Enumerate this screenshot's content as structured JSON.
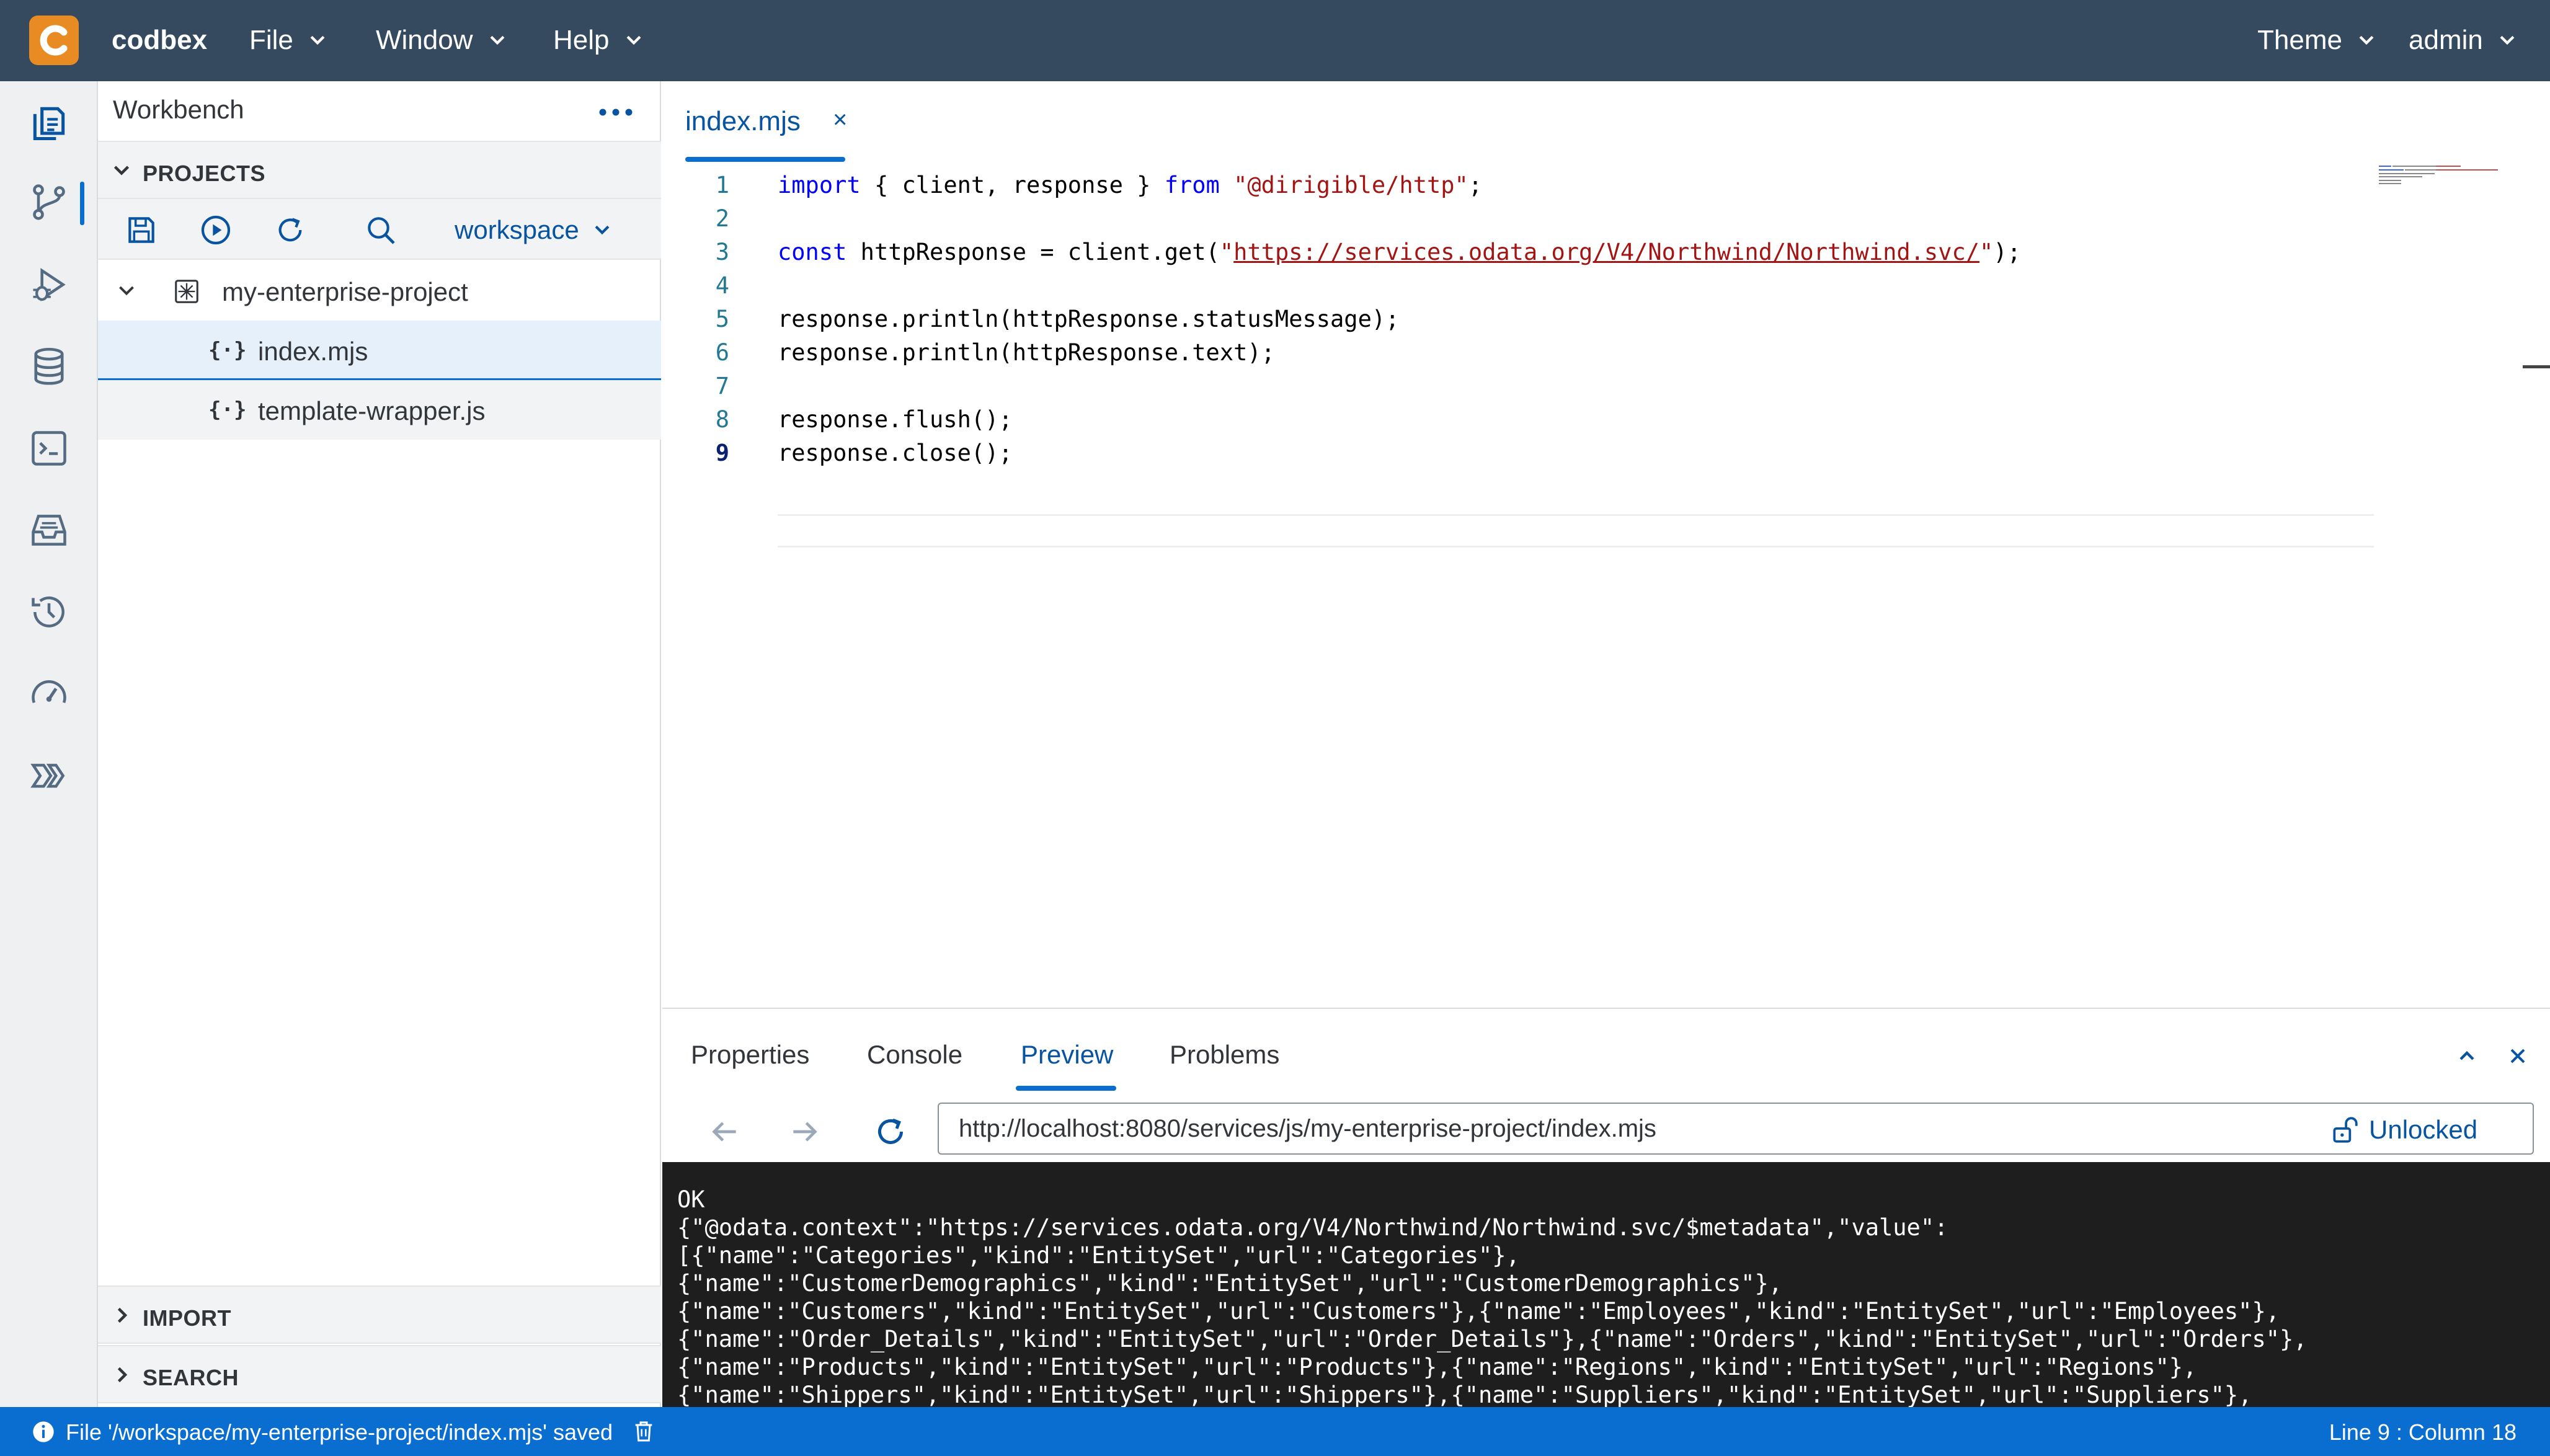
{
  "header": {
    "brand": "codbex",
    "menus": [
      {
        "label": "File"
      },
      {
        "label": "Window"
      },
      {
        "label": "Help"
      }
    ],
    "theme_label": "Theme",
    "user_label": "admin"
  },
  "activity_bar": {
    "icons": [
      "workbench-icon",
      "git-icon",
      "debug-icon",
      "database-icon",
      "terminal-icon",
      "inbox-icon",
      "history-icon",
      "dashboard-icon",
      "pipeline-icon"
    ],
    "active": "workbench-icon"
  },
  "workbench": {
    "title": "Workbench",
    "projects_label": "PROJECTS",
    "workspace_label": "workspace",
    "tree": [
      {
        "label": "my-enterprise-project",
        "type": "project"
      },
      {
        "label": "index.mjs",
        "type": "file",
        "selected": true
      },
      {
        "label": "template-wrapper.js",
        "type": "file"
      }
    ],
    "import_label": "IMPORT",
    "search_label": "SEARCH"
  },
  "editor": {
    "tab_label": "index.mjs",
    "tab_close": "×",
    "current_line": 9,
    "lines": [
      {
        "n": "1",
        "segments": [
          [
            "kw",
            "import"
          ],
          [
            "",
            "{ client, response } "
          ],
          [
            "kw",
            "from"
          ],
          [
            "",
            ""
          ],
          [
            "str",
            "\"@dirigible/http\""
          ],
          [
            "",
            ";"
          ]
        ]
      },
      {
        "n": "2",
        "segments": []
      },
      {
        "n": "3",
        "segments": [
          [
            "kw",
            "const"
          ],
          [
            "",
            " httpResponse = client.get("
          ],
          [
            "str",
            "\""
          ],
          [
            "url",
            "https://services.odata.org/V4/Northwind/Northwind.svc/"
          ],
          [
            "str",
            "\""
          ],
          [
            "",
            ");"
          ]
        ]
      },
      {
        "n": "4",
        "segments": []
      },
      {
        "n": "5",
        "segments": [
          [
            "",
            "response.println(httpResponse.statusMessage);"
          ]
        ]
      },
      {
        "n": "6",
        "segments": [
          [
            "",
            "response.println(httpResponse.text);"
          ]
        ]
      },
      {
        "n": "7",
        "segments": []
      },
      {
        "n": "8",
        "segments": [
          [
            "",
            "response.flush();"
          ]
        ]
      },
      {
        "n": "9",
        "segments": [
          [
            "",
            "response.close();"
          ]
        ]
      }
    ]
  },
  "bottom_panel": {
    "tabs": [
      {
        "label": "Properties"
      },
      {
        "label": "Console"
      },
      {
        "label": "Preview",
        "active": true
      },
      {
        "label": "Problems"
      }
    ],
    "url": "http://localhost:8080/services/js/my-enterprise-project/index.mjs",
    "lock_label": "Unlocked",
    "preview_lines": [
      "OK",
      "{\"@odata.context\":\"https://services.odata.org/V4/Northwind/Northwind.svc/$metadata\",\"value\":",
      "[{\"name\":\"Categories\",\"kind\":\"EntitySet\",\"url\":\"Categories\"},",
      "{\"name\":\"CustomerDemographics\",\"kind\":\"EntitySet\",\"url\":\"CustomerDemographics\"},",
      "{\"name\":\"Customers\",\"kind\":\"EntitySet\",\"url\":\"Customers\"},{\"name\":\"Employees\",\"kind\":\"EntitySet\",\"url\":\"Employees\"},",
      "{\"name\":\"Order_Details\",\"kind\":\"EntitySet\",\"url\":\"Order_Details\"},{\"name\":\"Orders\",\"kind\":\"EntitySet\",\"url\":\"Orders\"},",
      "{\"name\":\"Products\",\"kind\":\"EntitySet\",\"url\":\"Products\"},{\"name\":\"Regions\",\"kind\":\"EntitySet\",\"url\":\"Regions\"},",
      "{\"name\":\"Shippers\",\"kind\":\"EntitySet\",\"url\":\"Shippers\"},{\"name\":\"Suppliers\",\"kind\":\"EntitySet\",\"url\":\"Suppliers\"},"
    ]
  },
  "status_bar": {
    "message": "File '/workspace/my-enterprise-project/index.mjs' saved",
    "position": "Line 9 : Column 18"
  },
  "colors": {
    "header_bg": "#354a5f",
    "accent": "#0a6ed1",
    "link": "#0854a0",
    "logo": "#e98b23",
    "preview_bg": "#1e1e1e"
  }
}
